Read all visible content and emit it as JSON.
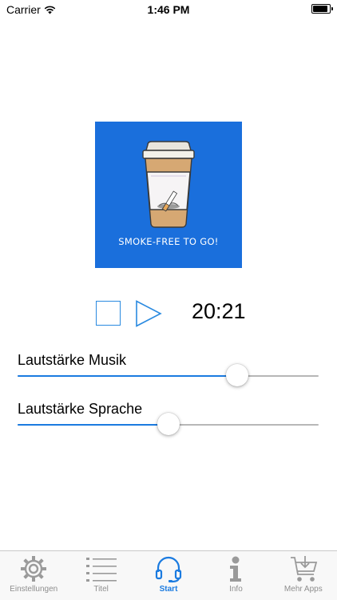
{
  "status_bar": {
    "carrier": "Carrier",
    "time": "1:46 PM",
    "battery_percent": 100
  },
  "artwork": {
    "caption": "SMOKE-FREE TO GO!",
    "background": "#1a6fdc"
  },
  "player": {
    "time": "20:21",
    "accent": "#1b7be0"
  },
  "sliders": [
    {
      "label": "Lautstärke Musik",
      "value": 0.73
    },
    {
      "label": "Lautstärke Sprache",
      "value": 0.5
    }
  ],
  "tabs": [
    {
      "label": "Einstellungen",
      "icon": "gear-icon",
      "active": false
    },
    {
      "label": "Titel",
      "icon": "list-icon",
      "active": false
    },
    {
      "label": "Start",
      "icon": "headphones-icon",
      "active": true
    },
    {
      "label": "Info",
      "icon": "info-icon",
      "active": false
    },
    {
      "label": "Mehr Apps",
      "icon": "cart-icon",
      "active": false
    }
  ]
}
